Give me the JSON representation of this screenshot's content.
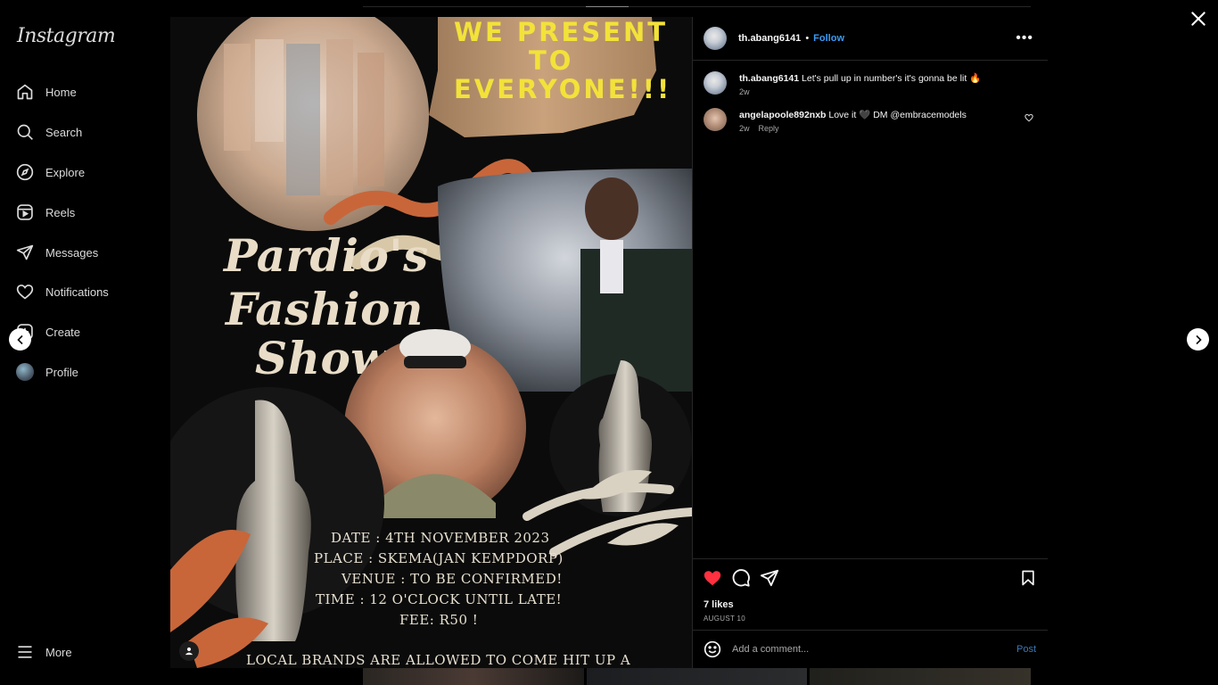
{
  "app": {
    "logo": "Instagram"
  },
  "sidebar": {
    "items": [
      {
        "label": "Home",
        "icon": "home-icon"
      },
      {
        "label": "Search",
        "icon": "search-icon"
      },
      {
        "label": "Explore",
        "icon": "compass-icon"
      },
      {
        "label": "Reels",
        "icon": "reels-icon"
      },
      {
        "label": "Messages",
        "icon": "send-icon"
      },
      {
        "label": "Notifications",
        "icon": "heart-icon"
      },
      {
        "label": "Create",
        "icon": "plus-square-icon"
      },
      {
        "label": "Profile",
        "icon": "avatar"
      }
    ],
    "more_label": "More"
  },
  "post": {
    "poster": {
      "headline_1": "WE PRESENT",
      "headline_2": "TO",
      "headline_3": "EVERYONE!!!",
      "title_1": "Pardio's",
      "title_2": "Fashion",
      "title_3": "Show",
      "date": "DATE : 4TH NOVEMBER 2023",
      "place": "PLACE : SKEMA(JAN KEMPDORP)",
      "venue": "VENUE : TO BE CONFIRMED!",
      "time": "TIME : 12 O'CLOCK  UNTIL LATE!",
      "fee": "FEE: R50 !",
      "footer": "LOCAL BRANDS ARE ALLOWED TO COME HIT UP A"
    },
    "author": {
      "username": "th.abang6141",
      "follow_label": "Follow",
      "separator": "•"
    },
    "comments": [
      {
        "username": "th.abang6141",
        "text": "Let's pull up in number's it's gonna be lit 🔥",
        "time": "2w"
      },
      {
        "username": "angelapoole892nxb",
        "text": "Love it 🖤 DM @embracemodels",
        "time": "2w",
        "reply_label": "Reply"
      }
    ],
    "likes": "7 likes",
    "date": "AUGUST 10",
    "add_comment": {
      "placeholder": "Add a comment...",
      "post_label": "Post"
    },
    "liked": true,
    "colors": {
      "like": "#ff3040",
      "link": "#3b9bf5",
      "poster_yellow": "#f2e23a",
      "poster_orange": "#c8663a"
    }
  }
}
